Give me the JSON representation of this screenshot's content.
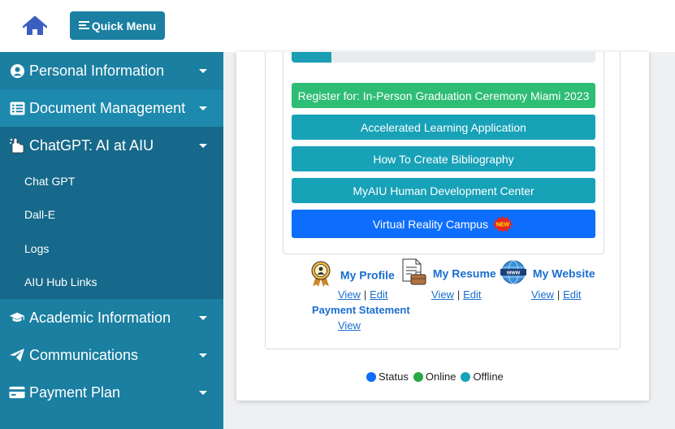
{
  "header": {
    "home_icon": "home-icon",
    "quick_menu_label": "Quick Menu"
  },
  "sidebar": {
    "items": [
      {
        "label": "Personal Information",
        "icon": "user-circle-icon"
      },
      {
        "label": "Document Management",
        "icon": "list-icon"
      },
      {
        "label": "ChatGPT: AI at AIU",
        "icon": "ai-hand-icon"
      },
      {
        "label": "Academic Information",
        "icon": "graduation-cap-icon"
      },
      {
        "label": "Communications",
        "icon": "paper-plane-icon"
      },
      {
        "label": "Payment Plan",
        "icon": "credit-card-icon"
      }
    ],
    "subitems": [
      "Chat GPT",
      "Dall-E",
      "Logs",
      "AIU Hub Links"
    ]
  },
  "main": {
    "progress_fraction": 0.13,
    "buttons": [
      "Register for: In-Person Graduation Ceremony Miami 2023",
      "Accelerated Learning Application",
      "How To Create Bibliography",
      "MyAIU Human Development Center",
      "Virtual Reality Campus"
    ],
    "new_badge": "NEW",
    "quick_links": {
      "profile": {
        "title": "My Profile",
        "view": "View",
        "edit": "Edit"
      },
      "resume": {
        "title": "My Resume",
        "view": "View",
        "edit": "Edit"
      },
      "website": {
        "title": "My Website",
        "view": "View",
        "edit": "Edit"
      },
      "payment": {
        "title": "Payment Statement",
        "view": "View"
      },
      "separator": "|"
    },
    "legend": [
      {
        "label": "Status",
        "color": "#0d6efd"
      },
      {
        "label": "Online",
        "color": "#28a745"
      },
      {
        "label": "Offline",
        "color": "#17a2b8"
      }
    ]
  }
}
